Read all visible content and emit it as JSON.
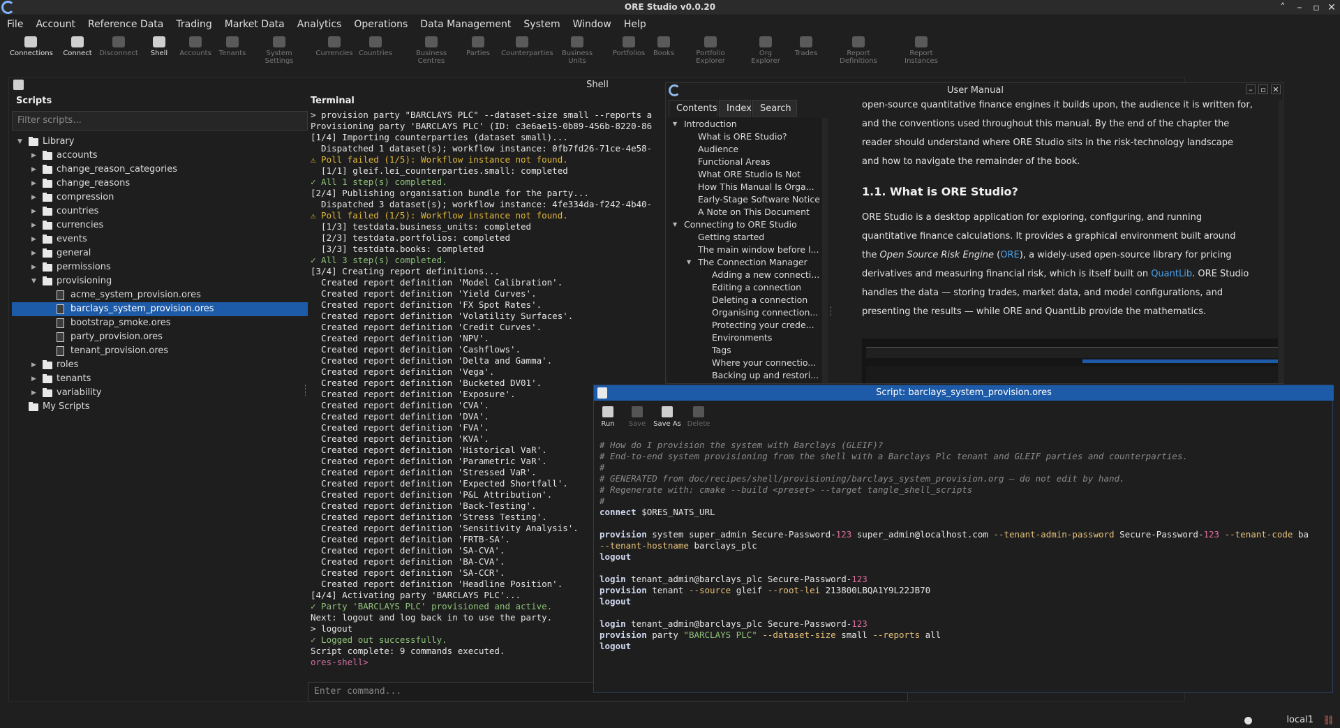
{
  "app": {
    "title": "ORE Studio v0.0.20"
  },
  "menu": [
    "File",
    "Account",
    "Reference Data",
    "Trading",
    "Market Data",
    "Analytics",
    "Operations",
    "Data Management",
    "System",
    "Window",
    "Help"
  ],
  "toolbar": [
    {
      "label": "Connections",
      "enabled": true
    },
    {
      "label": "Connect",
      "enabled": true
    },
    {
      "label": "Disconnect",
      "enabled": false
    },
    {
      "label": "Shell",
      "enabled": true
    },
    {
      "label": "Accounts",
      "enabled": false
    },
    {
      "label": "Tenants",
      "enabled": false
    },
    {
      "label": "System Settings",
      "enabled": false
    },
    {
      "label": "Currencies",
      "enabled": false
    },
    {
      "label": "Countries",
      "enabled": false
    },
    {
      "label": "Business Centres",
      "enabled": false
    },
    {
      "label": "Parties",
      "enabled": false
    },
    {
      "label": "Counterparties",
      "enabled": false
    },
    {
      "label": "Business Units",
      "enabled": false
    },
    {
      "label": "Portfolios",
      "enabled": false
    },
    {
      "label": "Books",
      "enabled": false
    },
    {
      "label": "Portfolio Explorer",
      "enabled": false
    },
    {
      "label": "Org Explorer",
      "enabled": false
    },
    {
      "label": "Trades",
      "enabled": false
    },
    {
      "label": "Report Definitions",
      "enabled": false
    },
    {
      "label": "Report Instances",
      "enabled": false
    }
  ],
  "shell": {
    "title": "Shell",
    "scripts_heading": "Scripts",
    "filter_placeholder": "Filter scripts...",
    "tree": [
      {
        "label": "Library",
        "type": "folder",
        "depth": 0,
        "expanded": true
      },
      {
        "label": "accounts",
        "type": "folder",
        "depth": 1
      },
      {
        "label": "change_reason_categories",
        "type": "folder",
        "depth": 1
      },
      {
        "label": "change_reasons",
        "type": "folder",
        "depth": 1
      },
      {
        "label": "compression",
        "type": "folder",
        "depth": 1
      },
      {
        "label": "countries",
        "type": "folder",
        "depth": 1
      },
      {
        "label": "currencies",
        "type": "folder",
        "depth": 1
      },
      {
        "label": "events",
        "type": "folder",
        "depth": 1
      },
      {
        "label": "general",
        "type": "folder",
        "depth": 1
      },
      {
        "label": "permissions",
        "type": "folder",
        "depth": 1
      },
      {
        "label": "provisioning",
        "type": "folder",
        "depth": 1,
        "expanded": true
      },
      {
        "label": "acme_system_provision.ores",
        "type": "file",
        "depth": 2
      },
      {
        "label": "barclays_system_provision.ores",
        "type": "file",
        "depth": 2,
        "selected": true
      },
      {
        "label": "bootstrap_smoke.ores",
        "type": "file",
        "depth": 2
      },
      {
        "label": "party_provision.ores",
        "type": "file",
        "depth": 2
      },
      {
        "label": "tenant_provision.ores",
        "type": "file",
        "depth": 2
      },
      {
        "label": "roles",
        "type": "folder",
        "depth": 1
      },
      {
        "label": "tenants",
        "type": "folder",
        "depth": 1
      },
      {
        "label": "variability",
        "type": "folder",
        "depth": 1
      },
      {
        "label": "My Scripts",
        "type": "folder",
        "depth": 0,
        "noarrow": true
      }
    ],
    "terminal_heading": "Terminal",
    "terminal_lines": [
      {
        "t": "> provision party \"BARCLAYS PLC\" --dataset-size small --reports a",
        "c": ""
      },
      {
        "t": "Provisioning party 'BARCLAYS PLC' (ID: c3e6ae15-0b89-456b-8220-86",
        "c": ""
      },
      {
        "t": "[1/4] Importing counterparties (dataset small)...",
        "c": ""
      },
      {
        "t": "  Dispatched 1 dataset(s); workflow instance: 0fb7fd26-71ce-4e58-",
        "c": ""
      },
      {
        "t": "⚠ Poll failed (1/5): Workflow instance not found.",
        "c": "warn"
      },
      {
        "t": "  [1/1] gleif.lei_counterparties.small: completed",
        "c": ""
      },
      {
        "t": "✓ All 1 step(s) completed.",
        "c": "ok"
      },
      {
        "t": "[2/4] Publishing organisation bundle for the party...",
        "c": ""
      },
      {
        "t": "  Dispatched 3 dataset(s); workflow instance: 4fe334da-f242-4b40-",
        "c": ""
      },
      {
        "t": "⚠ Poll failed (1/5): Workflow instance not found.",
        "c": "warn"
      },
      {
        "t": "  [1/3] testdata.business_units: completed",
        "c": ""
      },
      {
        "t": "  [2/3] testdata.portfolios: completed",
        "c": ""
      },
      {
        "t": "  [3/3] testdata.books: completed",
        "c": ""
      },
      {
        "t": "✓ All 3 step(s) completed.",
        "c": "ok"
      },
      {
        "t": "[3/4] Creating report definitions...",
        "c": ""
      },
      {
        "t": "  Created report definition 'Model Calibration'.",
        "c": ""
      },
      {
        "t": "  Created report definition 'Yield Curves'.",
        "c": ""
      },
      {
        "t": "  Created report definition 'FX Spot Rates'.",
        "c": ""
      },
      {
        "t": "  Created report definition 'Volatility Surfaces'.",
        "c": ""
      },
      {
        "t": "  Created report definition 'Credit Curves'.",
        "c": ""
      },
      {
        "t": "  Created report definition 'NPV'.",
        "c": ""
      },
      {
        "t": "  Created report definition 'Cashflows'.",
        "c": ""
      },
      {
        "t": "  Created report definition 'Delta and Gamma'.",
        "c": ""
      },
      {
        "t": "  Created report definition 'Vega'.",
        "c": ""
      },
      {
        "t": "  Created report definition 'Bucketed DV01'.",
        "c": ""
      },
      {
        "t": "  Created report definition 'Exposure'.",
        "c": ""
      },
      {
        "t": "  Created report definition 'CVA'.",
        "c": ""
      },
      {
        "t": "  Created report definition 'DVA'.",
        "c": ""
      },
      {
        "t": "  Created report definition 'FVA'.",
        "c": ""
      },
      {
        "t": "  Created report definition 'KVA'.",
        "c": ""
      },
      {
        "t": "  Created report definition 'Historical VaR'.",
        "c": ""
      },
      {
        "t": "  Created report definition 'Parametric VaR'.",
        "c": ""
      },
      {
        "t": "  Created report definition 'Stressed VaR'.",
        "c": ""
      },
      {
        "t": "  Created report definition 'Expected Shortfall'.",
        "c": ""
      },
      {
        "t": "  Created report definition 'P&L Attribution'.",
        "c": ""
      },
      {
        "t": "  Created report definition 'Back-Testing'.",
        "c": ""
      },
      {
        "t": "  Created report definition 'Stress Testing'.",
        "c": ""
      },
      {
        "t": "  Created report definition 'Sensitivity Analysis'.",
        "c": ""
      },
      {
        "t": "  Created report definition 'FRTB-SA'.",
        "c": ""
      },
      {
        "t": "  Created report definition 'SA-CVA'.",
        "c": ""
      },
      {
        "t": "  Created report definition 'BA-CVA'.",
        "c": ""
      },
      {
        "t": "  Created report definition 'SA-CCR'.",
        "c": ""
      },
      {
        "t": "  Created report definition 'Headline Position'.",
        "c": ""
      },
      {
        "t": "[4/4] Activating party 'BARCLAYS PLC'...",
        "c": ""
      },
      {
        "t": "✓ Party 'BARCLAYS PLC' provisioned and active.",
        "c": "ok"
      },
      {
        "t": "Next: logout and log back in to use the party.",
        "c": ""
      },
      {
        "t": "> logout",
        "c": ""
      },
      {
        "t": "✓ Logged out successfully.",
        "c": "ok"
      },
      {
        "t": "Script complete: 9 commands executed.",
        "c": ""
      },
      {
        "t": "ores-shell>",
        "c": "prompt"
      }
    ],
    "command_placeholder": "Enter command..."
  },
  "manual": {
    "title": "User Manual",
    "tabs": [
      "Contents",
      "Index",
      "Search"
    ],
    "active_tab": "Contents",
    "toc": [
      {
        "label": "Introduction",
        "depth": 0,
        "expanded": true
      },
      {
        "label": "What is ORE Studio?",
        "depth": 1
      },
      {
        "label": "Audience",
        "depth": 1
      },
      {
        "label": "Functional Areas",
        "depth": 1
      },
      {
        "label": "What ORE Studio Is Not",
        "depth": 1
      },
      {
        "label": "How This Manual Is Orga...",
        "depth": 1
      },
      {
        "label": "Early-Stage Software Notice",
        "depth": 1
      },
      {
        "label": "A Note on This Document",
        "depth": 1
      },
      {
        "label": "Connecting to ORE Studio",
        "depth": 0,
        "expanded": true
      },
      {
        "label": "Getting started",
        "depth": 1
      },
      {
        "label": "The main window before l...",
        "depth": 1
      },
      {
        "label": "The Connection Manager",
        "depth": 1,
        "expanded": true
      },
      {
        "label": "Adding a new connecti...",
        "depth": 2
      },
      {
        "label": "Editing a connection",
        "depth": 2
      },
      {
        "label": "Deleting a connection",
        "depth": 2
      },
      {
        "label": "Organising connection...",
        "depth": 2
      },
      {
        "label": "Protecting your crede...",
        "depth": 2
      },
      {
        "label": "Environments",
        "depth": 2
      },
      {
        "label": "Tags",
        "depth": 2
      },
      {
        "label": "Where your connectio...",
        "depth": 2
      },
      {
        "label": "Backing up and restori...",
        "depth": 2
      }
    ],
    "intro_para": "open-source quantitative finance engines it builds upon, the audience it is written for, and the conventions used throughout this manual. By the end of the chapter the reader should understand where ORE Studio sits in the risk-technology landscape and how to navigate the remainder of the book.",
    "section_heading": "1.1. What is ORE Studio?",
    "body_1": "ORE Studio is a desktop application for exploring, configuring, and running quantitative finance calculations. It provides a graphical environment built around the ",
    "body_em": "Open Source Risk Engine",
    "body_2": " (",
    "link_ore": "ORE",
    "body_3": "), a widely-used open-source library for pricing derivatives and measuring financial risk, which is itself built on ",
    "link_quantlib": "QuantLib",
    "body_4": ". ORE Studio handles the data — storing trades, market data, and model configurations, and presenting the results — while ORE and QuantLib provide the mathematics."
  },
  "editor": {
    "title": "Script: barclays_system_provision.ores",
    "buttons": [
      {
        "label": "Run",
        "enabled": true
      },
      {
        "label": "Save",
        "enabled": false
      },
      {
        "label": "Save As",
        "enabled": true
      },
      {
        "label": "Delete",
        "enabled": false
      }
    ],
    "lines": [
      [
        {
          "t": "# How do I provision the system with Barclays (GLEIF)?",
          "c": "cm"
        }
      ],
      [
        {
          "t": "# End-to-end system provisioning from the shell with a Barclays Plc tenant and GLEIF parties and counterparties.",
          "c": "cm"
        }
      ],
      [
        {
          "t": "#",
          "c": "cm"
        }
      ],
      [
        {
          "t": "# GENERATED from doc/recipes/shell/provisioning/barclays_system_provision.org — do not edit by hand.",
          "c": "cm"
        }
      ],
      [
        {
          "t": "# Regenerate with: cmake --build <preset> --target tangle_shell_scripts",
          "c": "cm"
        }
      ],
      [
        {
          "t": "#",
          "c": "cm"
        }
      ],
      [
        {
          "t": "connect",
          "c": "kw"
        },
        {
          "t": " $ORES_NATS_URL",
          "c": ""
        }
      ],
      [
        {
          "t": "",
          "c": ""
        }
      ],
      [
        {
          "t": "provision",
          "c": "kw"
        },
        {
          "t": " system super_admin Secure-Password-",
          "c": ""
        },
        {
          "t": "123",
          "c": "nm"
        },
        {
          "t": " super_admin@localhost.com ",
          "c": ""
        },
        {
          "t": "--tenant-admin-password",
          "c": "fl"
        },
        {
          "t": " Secure-Password-",
          "c": ""
        },
        {
          "t": "123",
          "c": "nm"
        },
        {
          "t": " ",
          "c": ""
        },
        {
          "t": "--tenant-code",
          "c": "fl"
        },
        {
          "t": " ba",
          "c": ""
        }
      ],
      [
        {
          "t": "--tenant-hostname",
          "c": "fl"
        },
        {
          "t": " barclays_plc",
          "c": ""
        }
      ],
      [
        {
          "t": "logout",
          "c": "kw"
        }
      ],
      [
        {
          "t": "",
          "c": ""
        }
      ],
      [
        {
          "t": "login",
          "c": "kw"
        },
        {
          "t": " tenant_admin@barclays_plc Secure-Password-",
          "c": ""
        },
        {
          "t": "123",
          "c": "nm"
        }
      ],
      [
        {
          "t": "provision",
          "c": "kw"
        },
        {
          "t": " tenant ",
          "c": ""
        },
        {
          "t": "--source",
          "c": "fl"
        },
        {
          "t": " gleif ",
          "c": ""
        },
        {
          "t": "--root-lei",
          "c": "fl"
        },
        {
          "t": " 213800LBQA1Y9L22JB70",
          "c": ""
        }
      ],
      [
        {
          "t": "logout",
          "c": "kw"
        }
      ],
      [
        {
          "t": "",
          "c": ""
        }
      ],
      [
        {
          "t": "login",
          "c": "kw"
        },
        {
          "t": " tenant_admin@barclays_plc Secure-Password-",
          "c": ""
        },
        {
          "t": "123",
          "c": "nm"
        }
      ],
      [
        {
          "t": "provision",
          "c": "kw"
        },
        {
          "t": " party ",
          "c": ""
        },
        {
          "t": "\"BARCLAYS PLC\"",
          "c": "str"
        },
        {
          "t": " ",
          "c": ""
        },
        {
          "t": "--dataset-size",
          "c": "fl"
        },
        {
          "t": " small ",
          "c": ""
        },
        {
          "t": "--reports",
          "c": "fl"
        },
        {
          "t": " all",
          "c": ""
        }
      ],
      [
        {
          "t": "logout",
          "c": "kw"
        }
      ]
    ]
  },
  "status": {
    "connection": "local1"
  }
}
